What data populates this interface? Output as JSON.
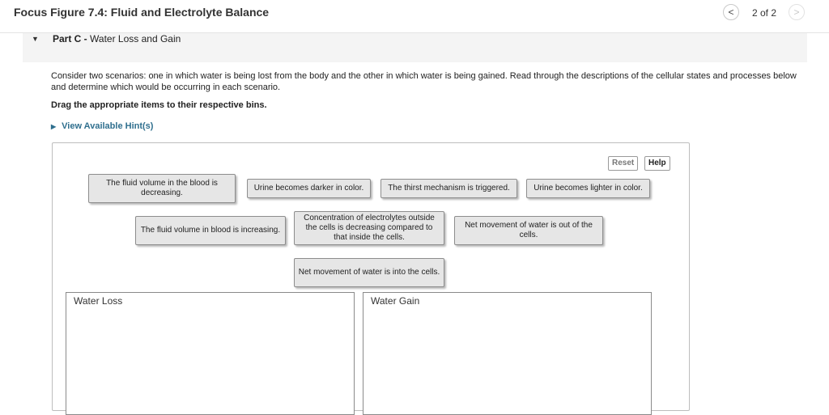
{
  "header": {
    "title": "Focus Figure 7.4: Fluid and Electrolyte Balance",
    "prev_icon": "chevron-left-icon",
    "next_icon": "chevron-right-icon",
    "prev_glyph": "<",
    "next_glyph": ">",
    "page_count": "2 of 2"
  },
  "part": {
    "caret_glyph": "▼",
    "label": "Part C -",
    "title": "Water Loss and Gain"
  },
  "question": {
    "text": "Consider two scenarios: one in which water is being lost from the body and the other in which water is being gained. Read through the descriptions of the cellular states and processes below and determine which would be occurring in each scenario.",
    "instruction": "Drag the appropriate items to their respective bins.",
    "hints_glyph": "▶",
    "hints_label": "View Available Hint(s)"
  },
  "toolbar": {
    "reset_label": "Reset",
    "help_label": "Help"
  },
  "items": [
    "The fluid volume in the blood is decreasing.",
    "Urine becomes darker in color.",
    "The thirst mechanism is triggered.",
    "Urine becomes lighter in color.",
    "The fluid volume in blood is increasing.",
    "Concentration of electrolytes outside the cells is decreasing compared to that inside the cells.",
    "Net movement of water is out of the cells.",
    "Net movement of water is into the cells."
  ],
  "bins": {
    "loss_label": "Water Loss",
    "gain_label": "Water Gain"
  },
  "colors": {
    "hint_link": "#2f6f8e",
    "chip_bg": "#e6e6e6",
    "part_bar_bg": "#f4f4f4"
  }
}
